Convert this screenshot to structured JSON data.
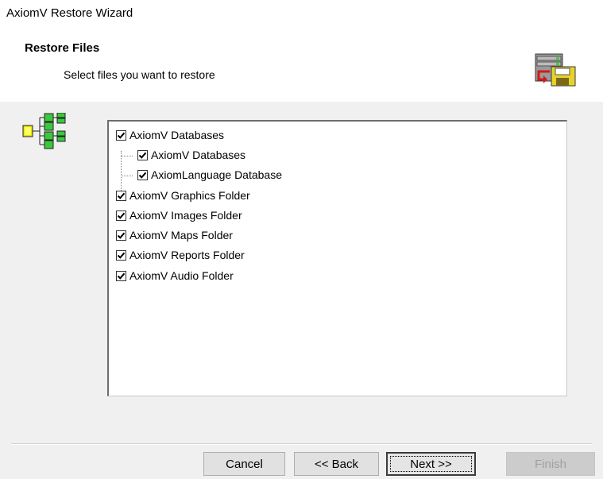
{
  "window": {
    "title": "AxiomV Restore Wizard"
  },
  "header": {
    "title": "Restore Files",
    "subtitle": "Select files you want to restore",
    "icon": "restore-server-icon"
  },
  "tree": {
    "icon": "tree-structure-icon",
    "items": [
      {
        "label": "AxiomV Databases",
        "checked": true,
        "level": 0
      },
      {
        "label": "AxiomV Databases",
        "checked": true,
        "level": 1
      },
      {
        "label": "AxiomLanguage Database",
        "checked": true,
        "level": 1
      },
      {
        "label": "AxiomV Graphics Folder",
        "checked": true,
        "level": 0
      },
      {
        "label": "AxiomV Images Folder",
        "checked": true,
        "level": 0
      },
      {
        "label": "AxiomV Maps Folder",
        "checked": true,
        "level": 0
      },
      {
        "label": "AxiomV Reports Folder",
        "checked": true,
        "level": 0
      },
      {
        "label": "AxiomV Audio Folder",
        "checked": true,
        "level": 0
      }
    ]
  },
  "buttons": {
    "cancel": "Cancel",
    "back": "<< Back",
    "next": "Next >>",
    "finish": "Finish"
  },
  "colors": {
    "window_bg": "#f0f0f0",
    "header_bg": "#ffffff",
    "disabled_text": "#a0a0a0"
  }
}
